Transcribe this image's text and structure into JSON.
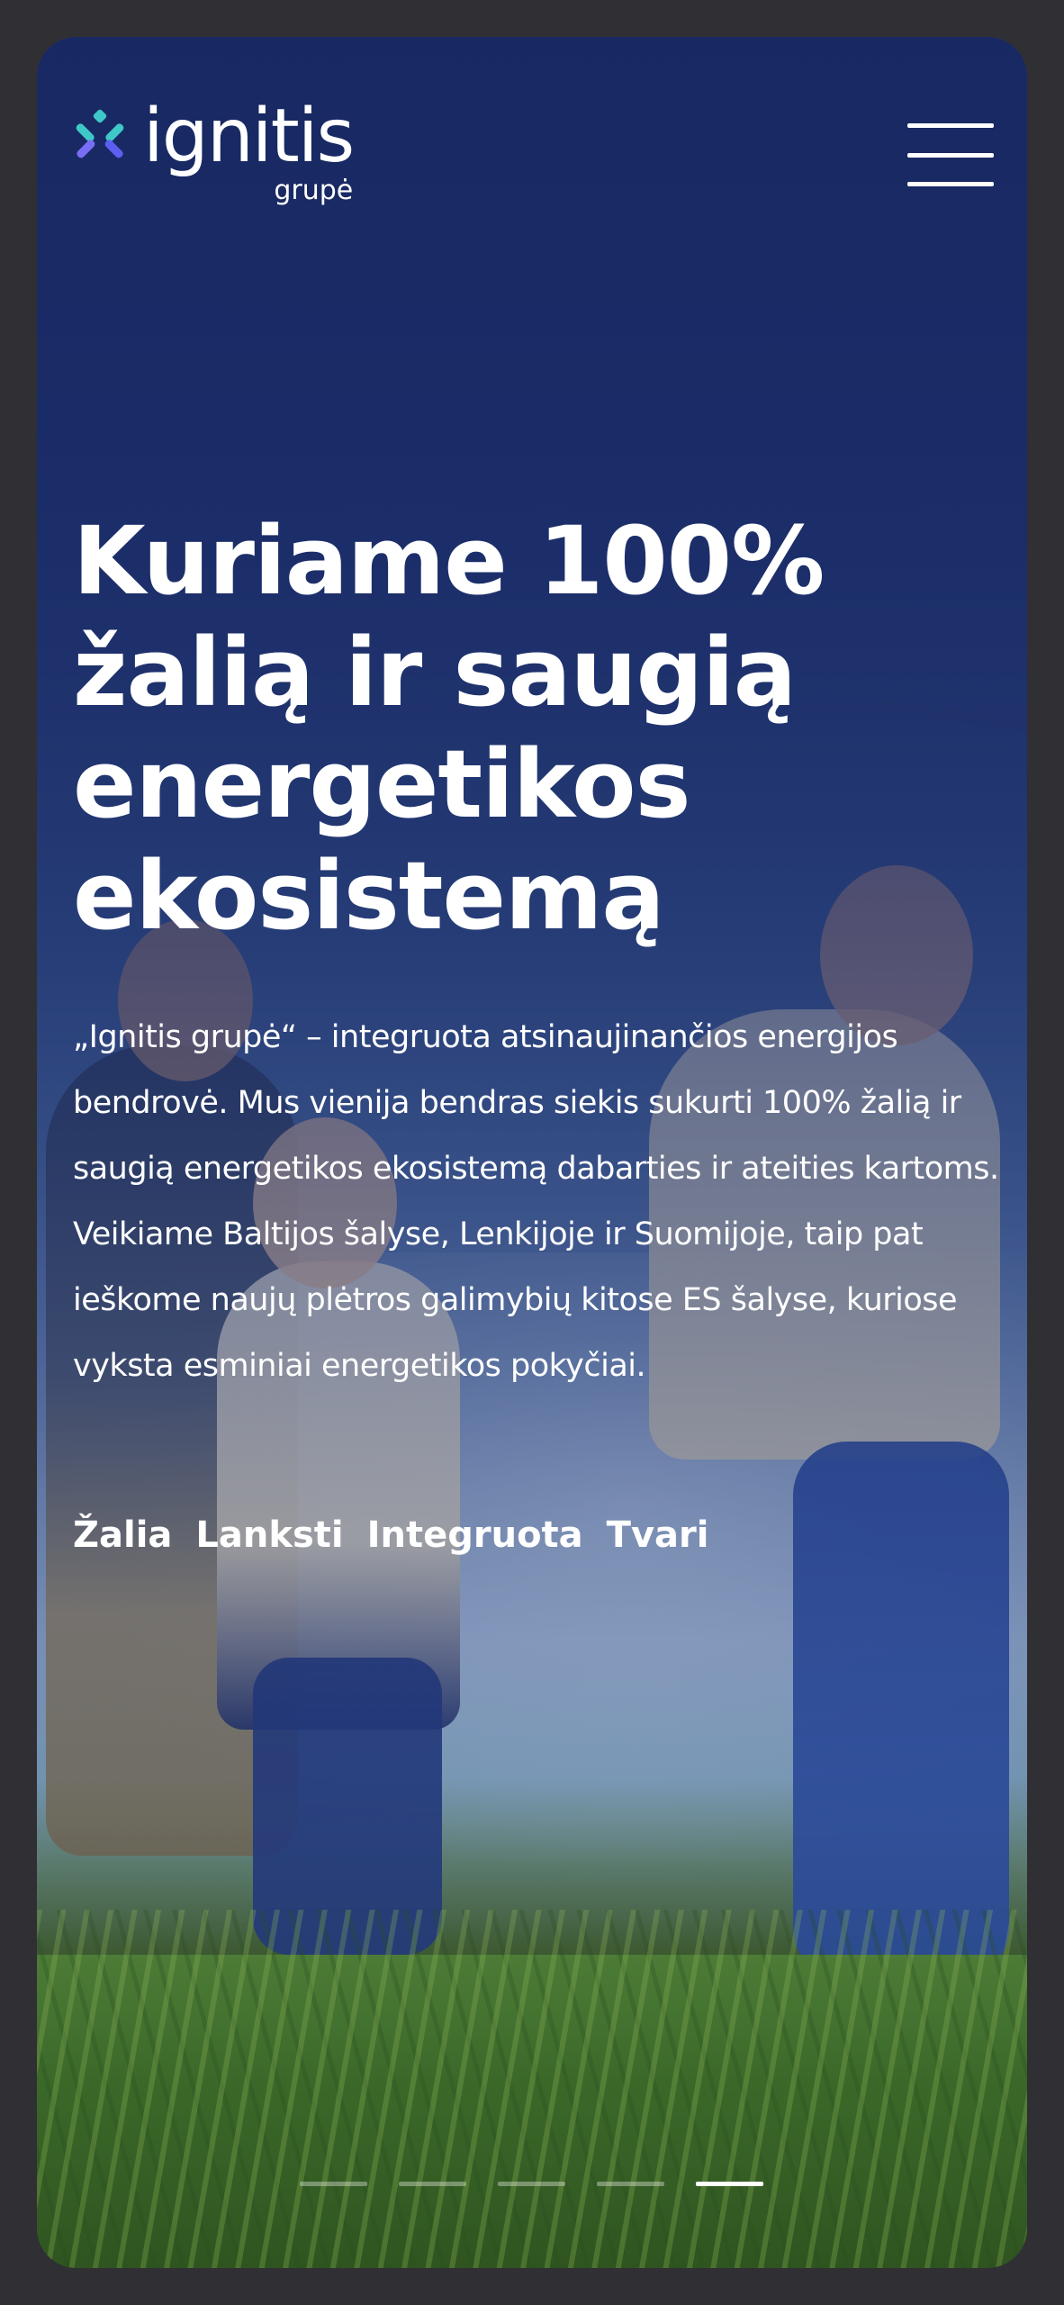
{
  "brand": {
    "name": "ignitis",
    "sub": "grupė",
    "mark_colors": [
      "#3fc8c8",
      "#5b5ff0",
      "#7a6df5"
    ]
  },
  "header": {
    "menu_icon": "hamburger-menu-icon"
  },
  "hero": {
    "headline": "Kuriame 100% žalią ir saugią energetikos ekosistemą",
    "lead": "„Ignitis grupė“ – integruota atsinaujinančios energijos bendrovė. Mus vienija bendras siekis sukurti 100% žalią ir saugią energetikos ekosistemą dabarties ir ateities kartoms. Veikiame Baltijos šalyse, Lenkijoje ir Suomijoje, taip pat ieškome naujų plėtros galimybių kitose ES šalyse, kuriose vyksta esminiai energetikos pokyčiai.",
    "tags": [
      "Žalia",
      "Lanksti",
      "Integruota",
      "Tvari"
    ]
  },
  "slider": {
    "count": 5,
    "active_index": 4
  },
  "colors": {
    "overlay": "#182862",
    "text": "#ffffff"
  }
}
